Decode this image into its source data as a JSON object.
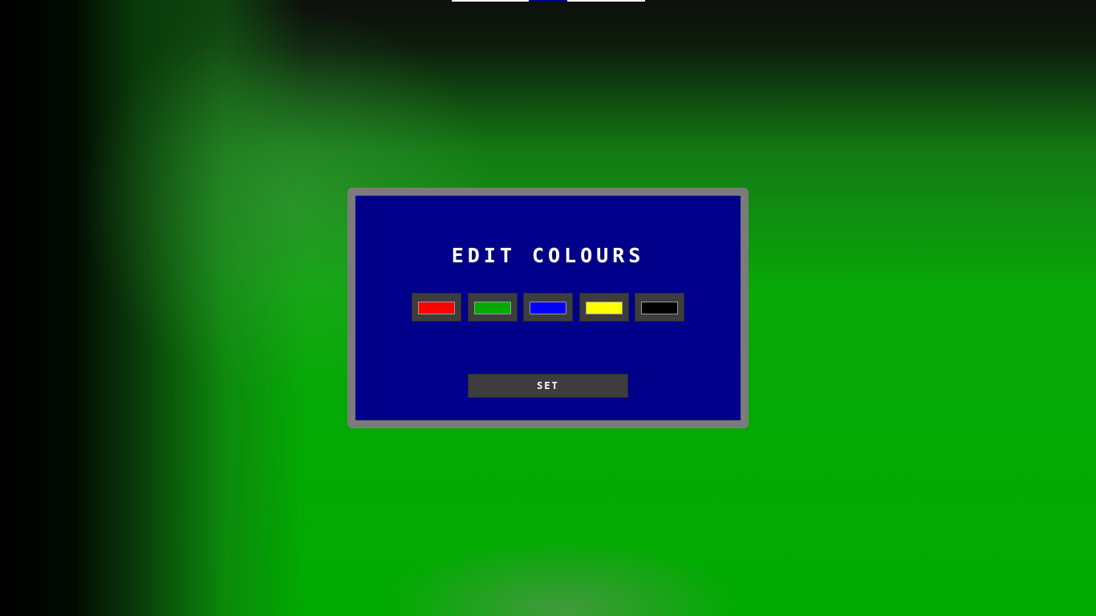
{
  "colors": {
    "background": "#00aa00",
    "dialog_frame": "#7b7b7b",
    "dialog_panel": "#00008a",
    "button": "#3d3d3d",
    "text": "#ffffff"
  },
  "dialog": {
    "title": "EDIT COLOURS",
    "swatches": [
      {
        "name": "red",
        "color": "#ff0000"
      },
      {
        "name": "green",
        "color": "#00aa00"
      },
      {
        "name": "blue",
        "color": "#0000ff"
      },
      {
        "name": "yellow",
        "color": "#ffff00"
      },
      {
        "name": "black",
        "color": "#000000"
      }
    ],
    "set_label": "SET"
  }
}
